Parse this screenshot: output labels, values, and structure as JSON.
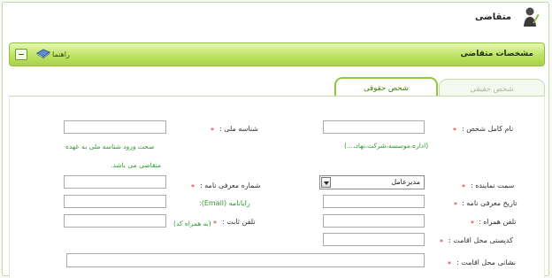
{
  "header": {
    "title": "متقاضی",
    "icon": "user-edit-icon"
  },
  "section": {
    "title": "مشخصات متقاضی",
    "help_label": "راهنما",
    "help_icon": "book-icon",
    "collapse_icon": "minus-icon"
  },
  "tabs": [
    {
      "label": "شخص حقیقی",
      "active": false
    },
    {
      "label": "شخص حقوقی",
      "active": true
    }
  ],
  "form": {
    "required_mark": "*",
    "full_name": {
      "label": "نام کامل شخص :",
      "hint": "(اداره،موسسه،شرکت،نهاد،...)",
      "value": ""
    },
    "national_id": {
      "label": "شناسه ملی :",
      "hint_line1": "صحت ورود شناسه ملی به عهده",
      "hint_line2": "متقاضی می باشد.",
      "value": ""
    },
    "representative_role": {
      "label": "سمت نماینده :",
      "value": "مدیرعامل"
    },
    "intro_letter_number": {
      "label": "شماره معرفی نامه :",
      "value": ""
    },
    "intro_letter_date": {
      "label": "تاریخ معرفی نامه :",
      "value": ""
    },
    "email": {
      "label": "رایانامه (Email):",
      "value": ""
    },
    "mobile": {
      "label": "تلفن همراه :",
      "value": ""
    },
    "landline": {
      "label": "تلفن ثابت :",
      "hint": "(به همراه کد)",
      "value": ""
    },
    "postal_code": {
      "label": "کدپستی محل اقامت :",
      "value": ""
    },
    "address": {
      "label": "نشانی محل اقامت :",
      "value": ""
    }
  },
  "colors": {
    "accent": "#8ec83d",
    "required": "#e0202a",
    "hint": "#2e9a2e"
  }
}
